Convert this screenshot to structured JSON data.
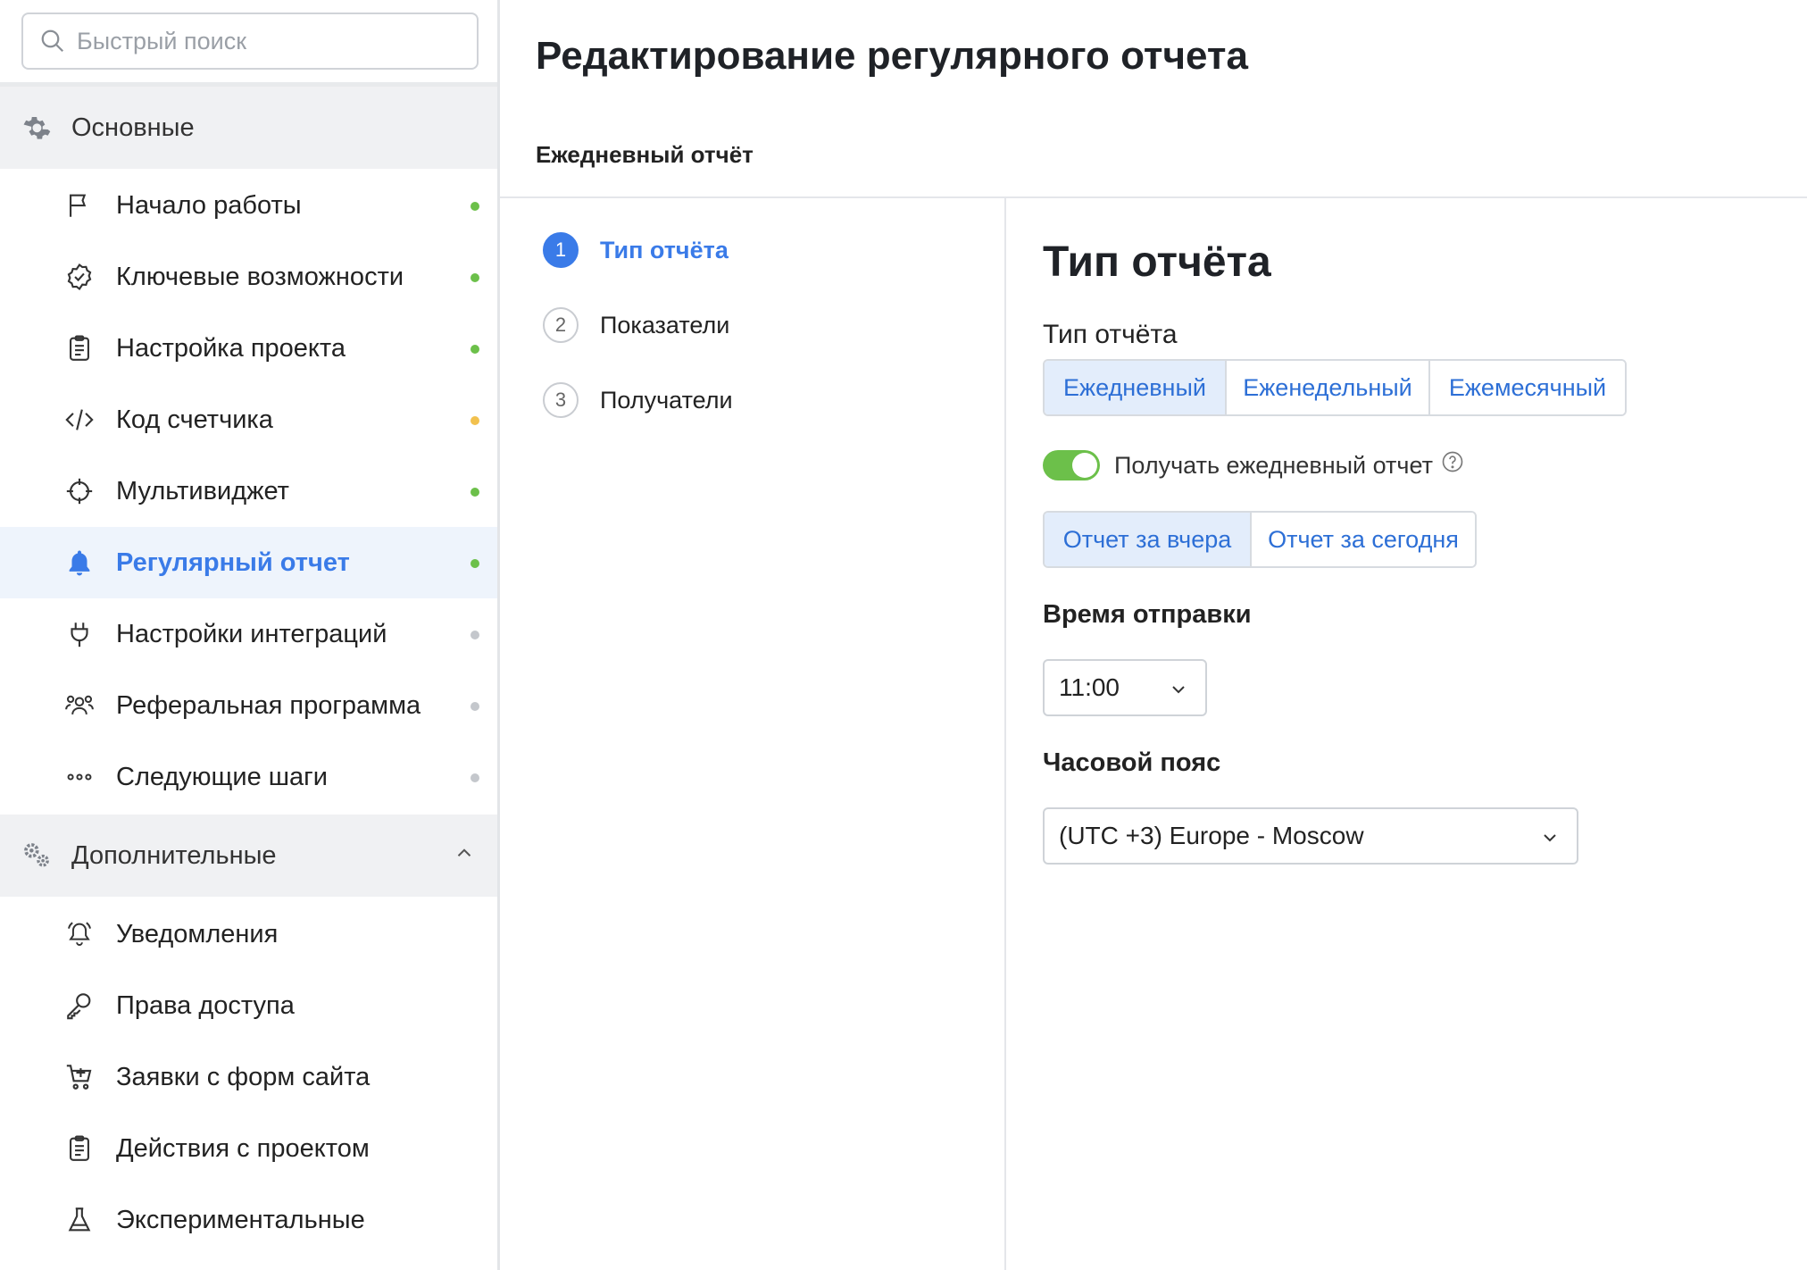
{
  "sidebar": {
    "search_placeholder": "Быстрый поиск",
    "main_group": {
      "label": "Основные",
      "icon": "gear-icon"
    },
    "main_items": [
      {
        "label": "Начало работы",
        "icon": "flag-icon",
        "status": "#6cc04a"
      },
      {
        "label": "Ключевые возможности",
        "icon": "check-badge-icon",
        "status": "#6cc04a"
      },
      {
        "label": "Настройка проекта",
        "icon": "clipboard-icon",
        "status": "#6cc04a"
      },
      {
        "label": "Код счетчика",
        "icon": "code-icon",
        "status": "#f2c14e"
      },
      {
        "label": "Мультивиджет",
        "icon": "crosshair-icon",
        "status": "#6cc04a"
      },
      {
        "label": "Регулярный отчет",
        "icon": "bell-icon",
        "status": "#6cc04a",
        "active": true
      },
      {
        "label": "Настройки интеграций",
        "icon": "plug-icon",
        "status": "#c4c7cc"
      },
      {
        "label": "Реферальная программа",
        "icon": "people-icon",
        "status": "#c4c7cc"
      },
      {
        "label": "Следующие шаги",
        "icon": "more-dots-icon",
        "status": "#c4c7cc"
      }
    ],
    "extra_group": {
      "label": "Дополнительные",
      "icon": "gears-icon"
    },
    "extra_items": [
      {
        "label": "Уведомления",
        "icon": "notification-bell-icon"
      },
      {
        "label": "Права доступа",
        "icon": "key-icon"
      },
      {
        "label": "Заявки с форм сайта",
        "icon": "cart-icon"
      },
      {
        "label": "Действия с проектом",
        "icon": "clipboard-list-icon"
      },
      {
        "label": "Экспериментальные",
        "icon": "flask-icon"
      }
    ]
  },
  "main": {
    "title": "Редактирование регулярного отчета",
    "subtab": "Ежедневный отчёт",
    "steps": [
      {
        "num": "1",
        "label": "Тип отчёта",
        "active": true
      },
      {
        "num": "2",
        "label": "Показатели"
      },
      {
        "num": "3",
        "label": "Получатели"
      }
    ],
    "content": {
      "title": "Тип отчёта",
      "type_label": "Тип отчёта",
      "report_types": [
        "Ежедневный",
        "Еженедельный",
        "Ежемесячный"
      ],
      "report_type_selected": 0,
      "toggle_label": "Получать ежедневный отчет",
      "toggle_on": true,
      "period_options": [
        "Отчет за вчера",
        "Отчет за сегодня"
      ],
      "period_selected": 0,
      "send_time_label": "Время отправки",
      "send_time": "11:00",
      "timezone_label": "Часовой пояс",
      "timezone": "(UTC +3) Europe - Moscow"
    }
  },
  "colors": {
    "accent": "#3a7be8",
    "toggle_on": "#6cc04a",
    "selected_bg": "#e3edfb",
    "active_nav_bg": "#eef4fc"
  }
}
